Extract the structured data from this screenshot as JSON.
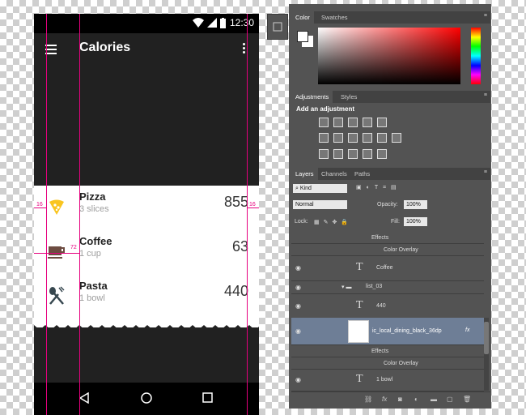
{
  "phone": {
    "status_time": "12:30",
    "title": "Calories",
    "items": [
      {
        "name": "Pizza",
        "detail": "3 slices",
        "value": "855",
        "icon": "pizza-icon",
        "icon_color": "#F9C520"
      },
      {
        "name": "Coffee",
        "detail": "1 cup",
        "value": "63",
        "icon": "coffee-cup-icon",
        "icon_color": "#6D4C41"
      },
      {
        "name": "Pasta",
        "detail": "1 bowl",
        "value": "440",
        "icon": "dining-icon",
        "icon_color": "#37474F"
      }
    ],
    "guides": {
      "left_margin": "16",
      "right_margin": "16",
      "keyline": "72"
    },
    "colors": {
      "appbar": "#212121",
      "guide": "#E6007E"
    }
  },
  "photoshop": {
    "color_tabs": [
      "Color",
      "Swatches"
    ],
    "adjust_tabs": [
      "Adjustments",
      "Styles"
    ],
    "adjust_title": "Add an adjustment",
    "layer_tabs": [
      "Layers",
      "Channels",
      "Paths"
    ],
    "filter_kind": "Kind",
    "blend_mode": "Normal",
    "opacity_label": "Opacity:",
    "opacity_value": "100%",
    "lock_label": "Lock:",
    "fill_label": "Fill:",
    "fill_value": "100%",
    "layers": [
      {
        "label": "Effects",
        "kind": "effects"
      },
      {
        "label": "Color Overlay",
        "kind": "effect"
      },
      {
        "label": "Coffee",
        "kind": "text"
      },
      {
        "label": "list_03",
        "kind": "group"
      },
      {
        "label": "440",
        "kind": "text"
      },
      {
        "label": "ic_local_dining_black_36dp",
        "kind": "image",
        "selected": true,
        "fx": "fx"
      },
      {
        "label": "Effects",
        "kind": "effects"
      },
      {
        "label": "Color Overlay",
        "kind": "effect"
      },
      {
        "label": "1 bowl",
        "kind": "text"
      }
    ]
  }
}
